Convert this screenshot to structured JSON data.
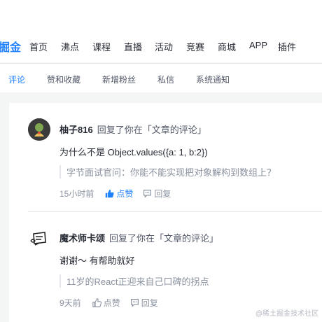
{
  "header": {
    "logo": "掘金",
    "nav": [
      "首页",
      "沸点",
      "课程",
      "直播",
      "活动",
      "竞赛",
      "商城",
      "APP",
      "插件"
    ]
  },
  "tabs": [
    "评论",
    "赞和收藏",
    "新增粉丝",
    "私信",
    "系统通知"
  ],
  "notifications": [
    {
      "user": "柚子816",
      "action": "回复了你在「文章的评论」",
      "content": "为什么不是 Object.values({a: 1, b:2})",
      "quote": "字节面试官问：你能不能实现把对象解构到数组上？",
      "time": "15小时前",
      "like_label": "点赞",
      "reply_label": "回复"
    },
    {
      "user": "魔术师卡颂",
      "action": "回复了你在「文章的评论」",
      "content": "谢谢～ 有帮助就好",
      "quote": "11岁的React正迎来自己口碑的拐点",
      "time": "9天前",
      "like_label": "点赞",
      "reply_label": "回复"
    }
  ],
  "watermark": "@稀土掘金技术社区",
  "colors": {
    "accent": "#1e80ff",
    "muted": "#8a919f",
    "background": "#f4f5f5"
  }
}
